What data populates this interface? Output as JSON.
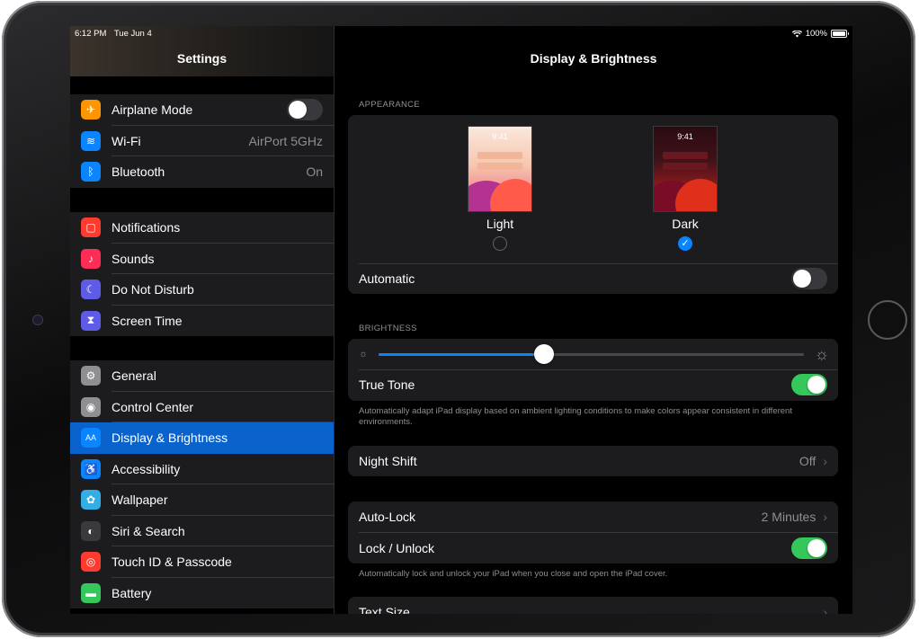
{
  "status": {
    "time": "6:12 PM",
    "date": "Tue Jun 4",
    "battery": "100%"
  },
  "sidebar": {
    "title": "Settings",
    "groups": [
      [
        {
          "label": "Airplane Mode",
          "icon": "airplane-icon",
          "color": "#ff9500",
          "accessory": "toggle",
          "on": false
        },
        {
          "label": "Wi-Fi",
          "icon": "wifi-icon",
          "color": "#0a84ff",
          "value": "AirPort 5GHz"
        },
        {
          "label": "Bluetooth",
          "icon": "bluetooth-icon",
          "color": "#0a84ff",
          "value": "On"
        }
      ],
      [
        {
          "label": "Notifications",
          "icon": "notifications-icon",
          "color": "#ff3b30"
        },
        {
          "label": "Sounds",
          "icon": "sounds-icon",
          "color": "#ff2d55"
        },
        {
          "label": "Do Not Disturb",
          "icon": "moon-icon",
          "color": "#5e5ce6"
        },
        {
          "label": "Screen Time",
          "icon": "hourglass-icon",
          "color": "#5e5ce6"
        }
      ],
      [
        {
          "label": "General",
          "icon": "gear-icon",
          "color": "#8e8e93"
        },
        {
          "label": "Control Center",
          "icon": "switches-icon",
          "color": "#8e8e93"
        },
        {
          "label": "Display & Brightness",
          "icon": "text-size-icon",
          "color": "#0a84ff",
          "selected": true
        },
        {
          "label": "Accessibility",
          "icon": "accessibility-icon",
          "color": "#0a84ff"
        },
        {
          "label": "Wallpaper",
          "icon": "flower-icon",
          "color": "#32ade6"
        },
        {
          "label": "Siri & Search",
          "icon": "siri-icon",
          "color": "#3a3a3c"
        },
        {
          "label": "Touch ID & Passcode",
          "icon": "fingerprint-icon",
          "color": "#ff3b30"
        },
        {
          "label": "Battery",
          "icon": "battery-icon",
          "color": "#34c759"
        }
      ]
    ]
  },
  "main": {
    "title": "Display & Brightness",
    "appearance": {
      "header": "APPEARANCE",
      "light_label": "Light",
      "dark_label": "Dark",
      "thumb_time": "9:41",
      "selected": "Dark",
      "automatic_label": "Automatic",
      "automatic_on": false
    },
    "brightness": {
      "header": "BRIGHTNESS",
      "level": 0.39,
      "true_tone_label": "True Tone",
      "true_tone_on": true,
      "footer": "Automatically adapt iPad display based on ambient lighting conditions to make colors appear consistent in different environments."
    },
    "night_shift": {
      "label": "Night Shift",
      "value": "Off"
    },
    "auto_lock": {
      "label": "Auto-Lock",
      "value": "2 Minutes"
    },
    "lock_unlock": {
      "label": "Lock / Unlock",
      "on": true,
      "footer": "Automatically lock and unlock your iPad when you close and open the iPad cover."
    },
    "text_size": {
      "label": "Text Size"
    }
  },
  "colors": {
    "accent": "#0a84ff",
    "toggle_on": "#34c759",
    "selected_row": "#0a63cc"
  }
}
